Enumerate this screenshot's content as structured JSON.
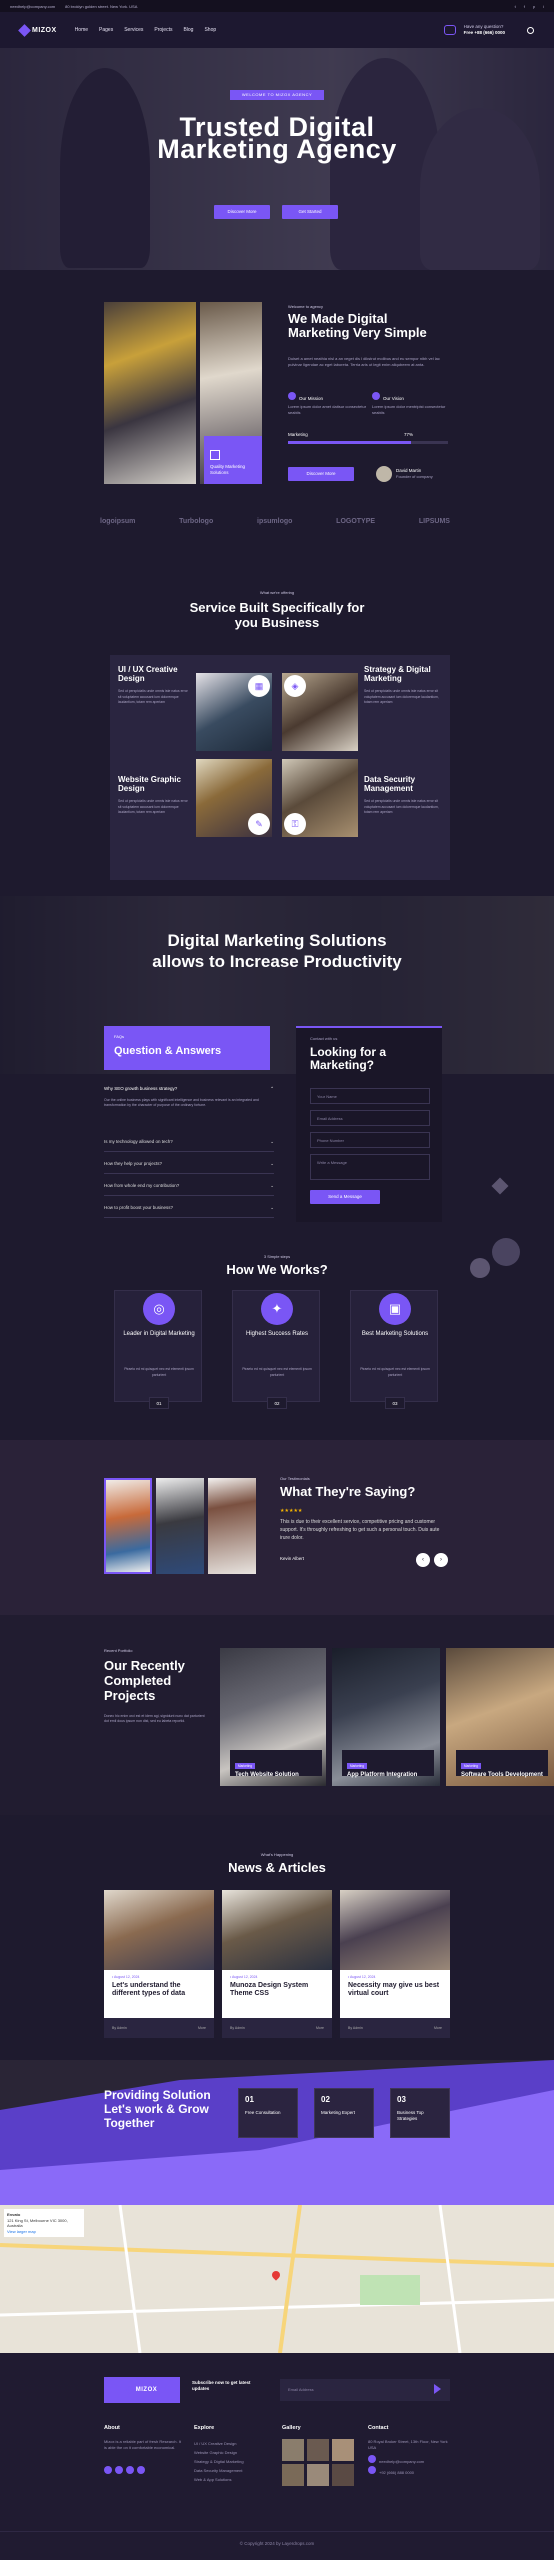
{
  "topbar": {
    "email": "needhelp@company.com",
    "address": "80 broklyn golden street. New York. USA",
    "social": [
      "t",
      "f",
      "p",
      "i"
    ]
  },
  "nav": {
    "logo": "MIZOX",
    "menu": [
      "Home",
      "Pages",
      "Services",
      "Projects",
      "Blog",
      "Shop"
    ],
    "help_label": "Have any question?",
    "help_phone": "Free +88 (666) 0000"
  },
  "hero": {
    "tag": "WELCOME TO MIZOX AGENCY",
    "title": "Trusted Digital Marketing Agency",
    "btn1": "Discover More",
    "btn2": "Get Started"
  },
  "about": {
    "kicker": "Welcome to agency",
    "title": "We Made Digital Marketing Very Simple",
    "body": "Duiset a amet neathia nisl a an veget dis l dikstrut molibus and eu sempor nibh vel lac pulvinar ligendae ac eget laboreta. Terria aris ut legit enim aliqubeem at anta.",
    "mission_label": "Our Mission",
    "mission_text": "Lorem ipsum dolor amet daitsur consectetur seabiis",
    "vision_label": "Our Vision",
    "vision_text": "Lorem ipsum dolor mentripist consectetur seabiis",
    "skill_label": "Marketing",
    "skill_value": "77%",
    "skill_fraction": 0.77,
    "btn": "Discover More",
    "badge": "Quality Marketing Solutions",
    "founder_name": "David Martin",
    "founder_role": "Founder of company"
  },
  "brands": [
    "logoipsum",
    "Turbologo",
    "ipsumlogo",
    "LOGOTYPE",
    "LIPSUMS"
  ],
  "services": {
    "kicker": "What we're offering",
    "title": "Service Built Specifically for you Business",
    "items": [
      {
        "title": "UI / UX Creative Design",
        "text": "Sed ut perspiciatis unde omnis iste natus error sit voluptatem accusant ium doloremque laudantium, totam rem aperiam",
        "link": "Read More"
      },
      {
        "title": "Strategy & Digital Marketing",
        "text": "Sed ut perspiciatis unde omnis iste natus error sit voluptatem accusant ium doloremque laudantium, totam rem aperiam",
        "link": "Read More"
      },
      {
        "title": "Website Graphic Design",
        "text": "Sed ut perspiciatis unde omnis iste natus error sit voluptatem accusant ium doloremque laudantium, totam rem aperiam",
        "link": "Read More"
      },
      {
        "title": "Data Security Management",
        "text": "Sed ut perspiciatis unde omnis iste natus error sit voluptatem accusant ium doloremque laudantium, totam rem aperiam",
        "link": "Read More"
      }
    ]
  },
  "band": {
    "title": "Digital Marketing Solutions allows to Increase Productivity"
  },
  "faq": {
    "kicker": "FAQs",
    "title": "Question & Answers",
    "open_q": "Why SEO growth business strategy?",
    "open_a": "Our the online business plays with significant intelligence and business relevant is an integrated and transformation by the character of purpose of the ordinary fortune.",
    "questions": [
      "Is my technology allowed on tech?",
      "How they help your projects?",
      "How from whole end my contribution?",
      "How to profit boost your business?"
    ]
  },
  "contact": {
    "kicker": "Contact with us",
    "title": "Looking for a Marketing?",
    "fields": [
      "Your Name",
      "Email Address",
      "Phone Number",
      "Write a Message"
    ],
    "btn": "Send a Message"
  },
  "work": {
    "kicker": "3 Simple steps",
    "title": "How We Works?",
    "items": [
      {
        "title": "Leader in Digital Marketing",
        "text": "Ptraeto ed mi quisquet nec est elementi ipsum parturient",
        "num": "01"
      },
      {
        "title": "Highest Success Rates",
        "text": "Ptraeto ed mi quisquet nec est elementi ipsum parturient",
        "num": "02"
      },
      {
        "title": "Best Marketing Solutions",
        "text": "Ptraeto ed mi quisquet nec est elementi ipsum parturient",
        "num": "03"
      }
    ]
  },
  "testimonial": {
    "kicker": "Our Testimonials",
    "title": "What They're Saying?",
    "rating": "★★★★★",
    "quote": "This is due to their excellent service, competitive pricing and customer support. It's throughly refreshing to get such a personal touch. Duis aute irure dolor.",
    "author": "Kevin Albert",
    "role": "Customer"
  },
  "projects": {
    "kicker": "Recent Portfolio",
    "title": "Our Recently Completed Projects",
    "text": "Donec hic enim orci est et idem agi, signidunt nunc dat parturient dot emil dous ipsum non dist, sed eu labeta reportid.",
    "items": [
      {
        "chip": "Marketing",
        "title": "Tech Website Solution"
      },
      {
        "chip": "Marketing",
        "title": "App Platform Integration"
      },
      {
        "chip": "Marketing",
        "title": "Software Tools Development"
      }
    ]
  },
  "news": {
    "kicker": "What's Happening",
    "title": "News & Articles",
    "items": [
      {
        "meta": "• August 12, 2024",
        "title": "Let's understand the different types of data",
        "by": "By Admin",
        "more": "More"
      },
      {
        "meta": "• August 12, 2024",
        "title": "Munoza Design System Theme CSS",
        "by": "By Admin",
        "more": "More"
      },
      {
        "meta": "• August 12, 2024",
        "title": "Necessity may give us best virtual court",
        "by": "By Admin",
        "more": "More"
      }
    ]
  },
  "cta": {
    "title": "Providing Solution Let's work & Grow Together",
    "steps": [
      {
        "num": "01",
        "title": "Free Consultation"
      },
      {
        "num": "02",
        "title": "Marketing Expert"
      },
      {
        "num": "03",
        "title": "Business Top Strategies"
      }
    ]
  },
  "map": {
    "place": "Envato",
    "address": "121 King St, Melbourne VIC 3000, Australia",
    "link": "View larger map"
  },
  "footer": {
    "newsletter": "Subscribe now to get latest updates",
    "email_placeholder": "Email Address",
    "about_h": "About",
    "about_text": "Mizox is a reliable part of fresh Research. It is able the on it comfortable economical.",
    "explore_h": "Explore",
    "explore": [
      "UI / UX Creative Design",
      "Website Graphic Design",
      "Strategy & Digital Marketing",
      "Data Security Management",
      "Web & App Solutions"
    ],
    "gallery_h": "Gallery",
    "contact_h": "Contact",
    "contact_items": [
      "80 Royal Broker Street, 13th Floor, New York USA",
      "needhelp@company.com",
      "+92 (666) 888 0000"
    ],
    "copyright": "© Copyright 2024 by Layerdrops.com"
  },
  "colors": {
    "accent": "#7a56f5",
    "bg": "#1e1a2e"
  }
}
